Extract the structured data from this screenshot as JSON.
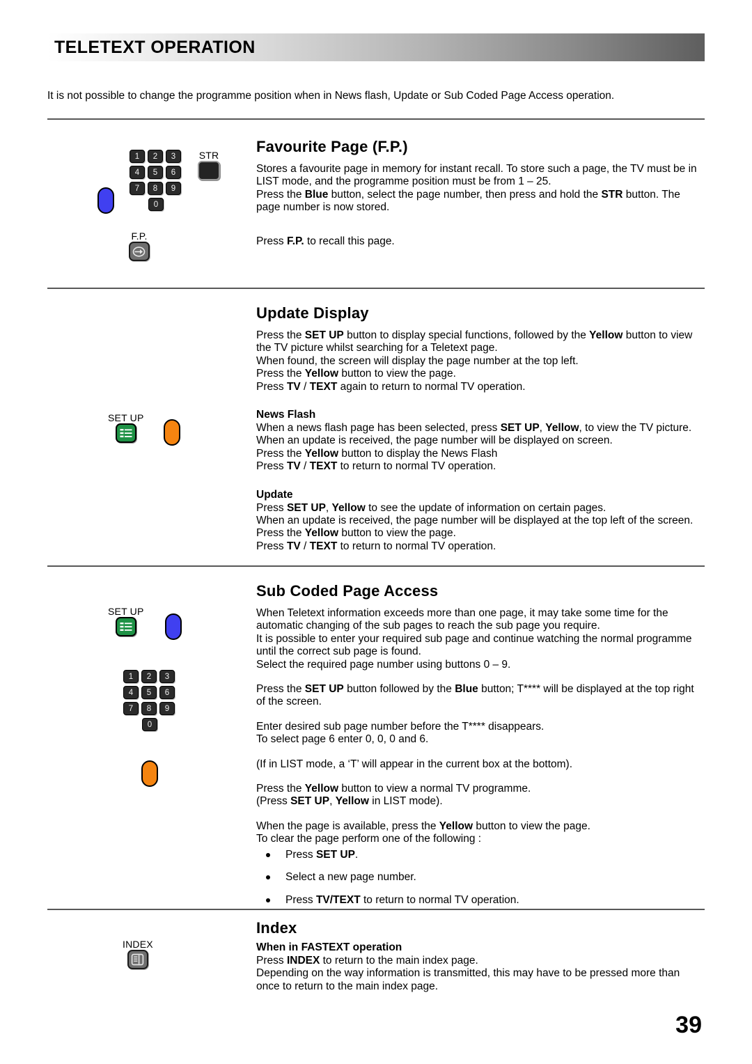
{
  "header": {
    "title": "TELETEXT OPERATION"
  },
  "intro": "It is not possible to change the programme position when in News flash, Update or Sub Coded Page Access operation.",
  "keypad": {
    "keys": [
      "1",
      "2",
      "3",
      "4",
      "5",
      "6",
      "7",
      "8",
      "9",
      "0"
    ],
    "row1": [
      "1",
      "2",
      "3"
    ],
    "row2": [
      "4",
      "5",
      "6"
    ],
    "row3": [
      "7",
      "8",
      "9"
    ],
    "row4": [
      "0"
    ]
  },
  "labels": {
    "str": "STR",
    "fp": "F.P.",
    "setup": "SET UP",
    "index": "INDEX"
  },
  "sections": {
    "favourite_page": {
      "title": "Favourite Page (F.P.)",
      "p1_a": "Stores a favourite page in memory for instant recall. To store such a page, the TV must be in LIST mode, and the programme position must be from 1 – 25.",
      "p2_pre": "Press the ",
      "p2_b1": "Blue",
      "p2_mid": " button, select the page number, then press and hold the ",
      "p2_b2": "STR",
      "p2_post": " button. The page number is now stored.",
      "p3_pre": "Press ",
      "p3_b1": "F.P.",
      "p3_post": " to recall this page."
    },
    "update_display": {
      "title": "Update Display",
      "p1_pre": "Press the ",
      "p1_b1": "SET UP",
      "p1_mid1": " button to display special functions, followed by the ",
      "p1_b2": "Yellow",
      "p1_post": " button to view the TV picture whilst searching for a Teletext page.",
      "p2": "When found, the screen will display the page number at the top left.",
      "p3_pre": "Press the ",
      "p3_b1": "Yellow",
      "p3_post": " button to view the page.",
      "p4_pre": "Press ",
      "p4_b1": "TV",
      "p4_mid": " / ",
      "p4_b2": "TEXT",
      "p4_post": " again to return to normal TV operation.",
      "news_flash": {
        "heading": "News Flash",
        "p1_pre": "When a news flash page has been selected, press ",
        "p1_b1": "SET UP",
        "p1_mid": ", ",
        "p1_b2": "Yellow",
        "p1_post": ", to view the TV picture. When an update is received, the page number will be displayed on screen.",
        "p2_pre": "Press the ",
        "p2_b1": "Yellow",
        "p2_post": " button to display the News Flash",
        "p3_pre": "Press ",
        "p3_b1": "TV",
        "p3_mid": " / ",
        "p3_b2": "TEXT",
        "p3_post": " to return to normal TV operation."
      },
      "update": {
        "heading": "Update",
        "p1_pre": "Press ",
        "p1_b1": "SET UP",
        "p1_mid": ", ",
        "p1_b2": "Yellow",
        "p1_post": " to see the update of information on certain pages.",
        "p2": "When an update is received, the page number will be displayed at the top left of the screen.",
        "p3_pre": "Press the ",
        "p3_b1": "Yellow",
        "p3_post": " button to view the page.",
        "p4_pre": "Press ",
        "p4_b1": "TV",
        "p4_mid": " / ",
        "p4_b2": "TEXT",
        "p4_post": " to return to normal TV operation."
      }
    },
    "sub_coded": {
      "title": "Sub Coded Page Access",
      "p1": "When Teletext information exceeds more than one page, it may take some time for the automatic changing of the sub pages to reach the sub page you require.",
      "p2": "It is possible to enter your required sub page and continue watching the normal programme until the correct sub page is found.",
      "p3": "Select the required page number using buttons 0 – 9.",
      "p4_pre": "Press the ",
      "p4_b1": "SET UP",
      "p4_mid": " button followed by the ",
      "p4_b2": "Blue",
      "p4_post": " button; T**** will be displayed at the top right of the screen.",
      "p5": "Enter desired sub page number before the T**** disappears.",
      "p6": "To select page 6 enter 0, 0, 0 and 6.",
      "p7": "(If in LIST mode, a ‘T’ will appear in the current box at the bottom).",
      "p8_pre": "Press the ",
      "p8_b1": "Yellow",
      "p8_post": " button to view a normal TV programme.",
      "p9_pre": "(Press ",
      "p9_b1": "SET UP",
      "p9_mid": ", ",
      "p9_b2": "Yellow",
      "p9_post": " in LIST mode).",
      "p10_pre": "When the page is available, press the ",
      "p10_b1": "Yellow",
      "p10_post": " button to view the page.",
      "p11": "To clear the page perform one of the following :",
      "bullet1_pre": "Press ",
      "bullet1_b": "SET UP",
      "bullet1_post": ".",
      "bullet2": "Select a new page number.",
      "bullet3_pre": "Press ",
      "bullet3_b": "TV/TEXT",
      "bullet3_post": " to return to normal TV operation."
    },
    "index": {
      "title": "Index",
      "heading": "When in FASTEXT operation",
      "p1_pre": "Press ",
      "p1_b1": "INDEX",
      "p1_post": " to return to the main index page.",
      "p2": "Depending on the way information is transmitted, this may have to be pressed more than once to return to the main index page."
    }
  },
  "page_number": "39",
  "colors": {
    "blue_button": "#4040f0",
    "yellow_button": "#f58410",
    "setup_green": "#1f9246",
    "keypad_dark": "#2b2b2b",
    "gray_button": "#6f6f6f"
  }
}
